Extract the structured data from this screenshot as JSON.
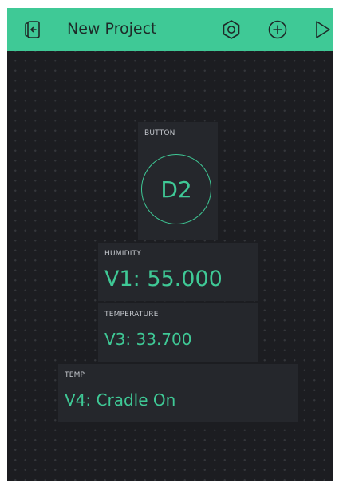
{
  "app": {
    "title": "New Project"
  },
  "icons": {
    "exit": "exit-icon",
    "settings": "hexagon-nut-icon",
    "add": "plus-circle-icon",
    "play": "play-icon"
  },
  "colors": {
    "accent": "#3fc996",
    "background": "#1b1c20",
    "widget": "#25272c"
  },
  "widgets": {
    "button": {
      "label": "BUTTON",
      "pin": "D2"
    },
    "humidity": {
      "label": "HUMIDITY",
      "value": "V1: 55.000"
    },
    "temperature": {
      "label": "TEMPERATURE",
      "value": "V3: 33.700"
    },
    "temp": {
      "label": "TEMP",
      "value": "V4: Cradle On"
    }
  }
}
